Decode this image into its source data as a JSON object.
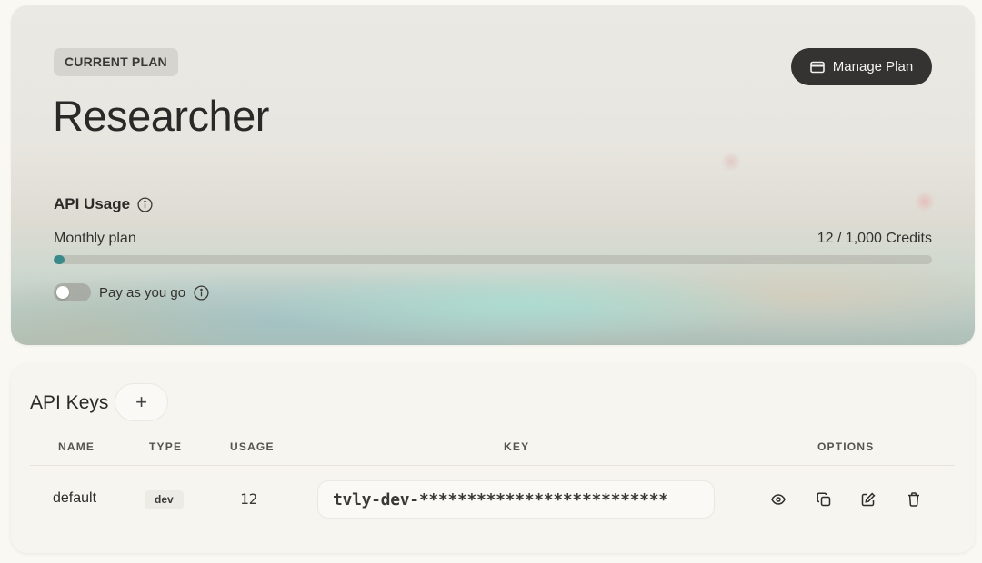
{
  "plan": {
    "badge": "CURRENT PLAN",
    "name": "Researcher",
    "manage_label": "Manage Plan"
  },
  "usage": {
    "title": "API Usage",
    "period_label": "Monthly plan",
    "credits_label": "12 / 1,000 Credits",
    "credits_used": 12,
    "credits_total": 1000,
    "progress_color": "#3b8a8a",
    "payg_label": "Pay as you go",
    "payg_enabled": false
  },
  "api_keys": {
    "title": "API Keys",
    "add_label": "+",
    "columns": [
      "NAME",
      "TYPE",
      "USAGE",
      "KEY",
      "OPTIONS"
    ],
    "rows": [
      {
        "name": "default",
        "type": "dev",
        "usage": "12",
        "key": "tvly-dev-**************************"
      }
    ]
  },
  "icons": {
    "manage_plan": "credit-card-icon",
    "info": "info-icon",
    "view": "eye-icon",
    "copy": "copy-icon",
    "edit": "edit-icon",
    "delete": "trash-icon"
  }
}
